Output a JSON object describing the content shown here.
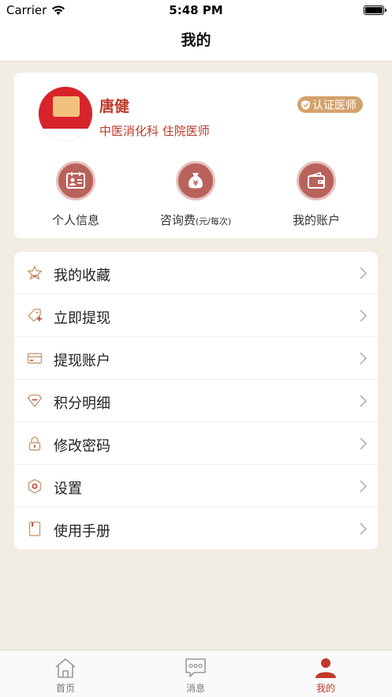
{
  "status_bar": {
    "carrier": "Carrier",
    "time": "5:48 PM"
  },
  "nav": {
    "title": "我的"
  },
  "profile": {
    "name": "唐健",
    "department_title": "中医消化科  住院医师",
    "badge": "认证医师"
  },
  "quick_actions": [
    {
      "label": "个人信息",
      "sub": "",
      "icon": "id-card-icon"
    },
    {
      "label": "咨询费",
      "sub": "(元/每次)",
      "icon": "money-bag-icon"
    },
    {
      "label": "我的账户",
      "sub": "",
      "icon": "wallet-icon"
    }
  ],
  "menu": [
    {
      "label": "我的收藏",
      "icon": "star-icon"
    },
    {
      "label": "立即提现",
      "icon": "tag-plus-icon"
    },
    {
      "label": "提现账户",
      "icon": "card-icon"
    },
    {
      "label": "积分明细",
      "icon": "diamond-icon"
    },
    {
      "label": "修改密码",
      "icon": "lock-icon"
    },
    {
      "label": "设置",
      "icon": "hexagon-settings-icon"
    },
    {
      "label": "使用手册",
      "icon": "manual-icon"
    }
  ],
  "tabs": [
    {
      "label": "首页",
      "icon": "home-icon",
      "active": false
    },
    {
      "label": "消息",
      "icon": "message-icon",
      "active": false
    },
    {
      "label": "我的",
      "icon": "profile-icon",
      "active": true
    }
  ],
  "colors": {
    "accent": "#c0392b",
    "badge": "#d4a26b",
    "icon_line": "#c9a07a",
    "background": "#f1ece4"
  }
}
